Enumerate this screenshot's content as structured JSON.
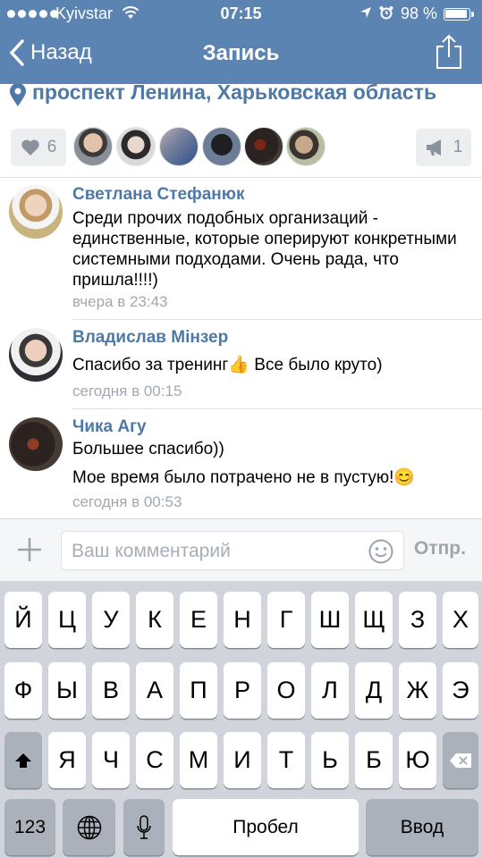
{
  "status_bar": {
    "carrier": "Kyivstar",
    "time": "07:15",
    "battery_percent": "98 %"
  },
  "nav": {
    "back_label": "Назад",
    "title": "Запись"
  },
  "location": {
    "text": "проспект Ленина, Харьковская область"
  },
  "likes": {
    "like_count": "6",
    "repost_count": "1"
  },
  "comments": [
    {
      "author": "Светлана Стефанюк",
      "text": "Среди прочих подобных организаций - единственные, которые оперируют конкретными системными подходами. Очень рада, что пришла!!!!)",
      "time": "вчера в 23:43"
    },
    {
      "author": "Владислав Мінзер",
      "text": "Спасибо за тренинг",
      "emoji": "👍",
      "text_after": " Все было круто)",
      "time": "сегодня в 00:15"
    },
    {
      "author": "Чика Агу",
      "text_line1": "Большее спасибо))",
      "text_line2": "Мое время было потрачено не в пустую!",
      "emoji": "😊",
      "time": "сегодня в 00:53"
    }
  ],
  "composer": {
    "placeholder": "Ваш комментарий",
    "send_label": "Отпр."
  },
  "keyboard": {
    "row1": [
      "Й",
      "Ц",
      "У",
      "К",
      "Е",
      "Н",
      "Г",
      "Ш",
      "Щ",
      "З",
      "Х"
    ],
    "row2": [
      "Ф",
      "Ы",
      "В",
      "А",
      "П",
      "Р",
      "О",
      "Л",
      "Д",
      "Ж",
      "Э"
    ],
    "row3": [
      "Я",
      "Ч",
      "С",
      "М",
      "И",
      "Т",
      "Ь",
      "Б",
      "Ю"
    ],
    "numbers_label": "123",
    "space_label": "Пробел",
    "return_label": "Ввод"
  },
  "colors": {
    "nav_background": "#5b84b2",
    "link_blue": "#4e79a7",
    "keyboard_background": "#d1d5db"
  }
}
